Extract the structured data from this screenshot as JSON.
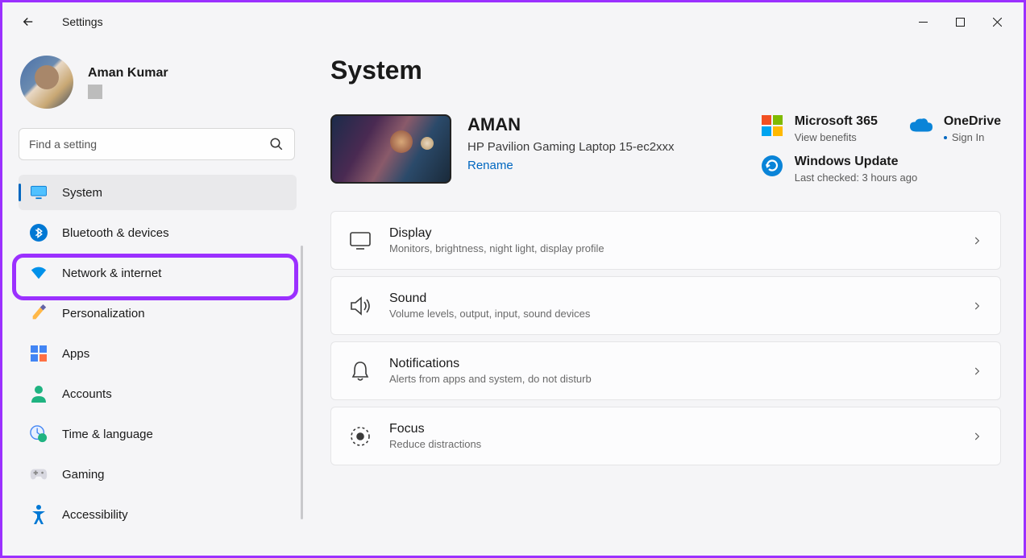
{
  "window": {
    "title": "Settings"
  },
  "user": {
    "name": "Aman Kumar"
  },
  "search": {
    "placeholder": "Find a setting"
  },
  "nav": {
    "items": [
      {
        "label": "System"
      },
      {
        "label": "Bluetooth & devices"
      },
      {
        "label": "Network & internet"
      },
      {
        "label": "Personalization"
      },
      {
        "label": "Apps"
      },
      {
        "label": "Accounts"
      },
      {
        "label": "Time & language"
      },
      {
        "label": "Gaming"
      },
      {
        "label": "Accessibility"
      }
    ]
  },
  "page": {
    "title": "System",
    "device": {
      "name": "AMAN",
      "model": "HP Pavilion Gaming Laptop 15-ec2xxx",
      "rename": "Rename"
    },
    "status": {
      "ms365": {
        "title": "Microsoft 365",
        "sub": "View benefits"
      },
      "onedrive": {
        "title": "OneDrive",
        "sub": "Sign In"
      },
      "update": {
        "title": "Windows Update",
        "sub": "Last checked: 3 hours ago"
      }
    },
    "cards": [
      {
        "title": "Display",
        "sub": "Monitors, brightness, night light, display profile"
      },
      {
        "title": "Sound",
        "sub": "Volume levels, output, input, sound devices"
      },
      {
        "title": "Notifications",
        "sub": "Alerts from apps and system, do not disturb"
      },
      {
        "title": "Focus",
        "sub": "Reduce distractions"
      }
    ]
  }
}
